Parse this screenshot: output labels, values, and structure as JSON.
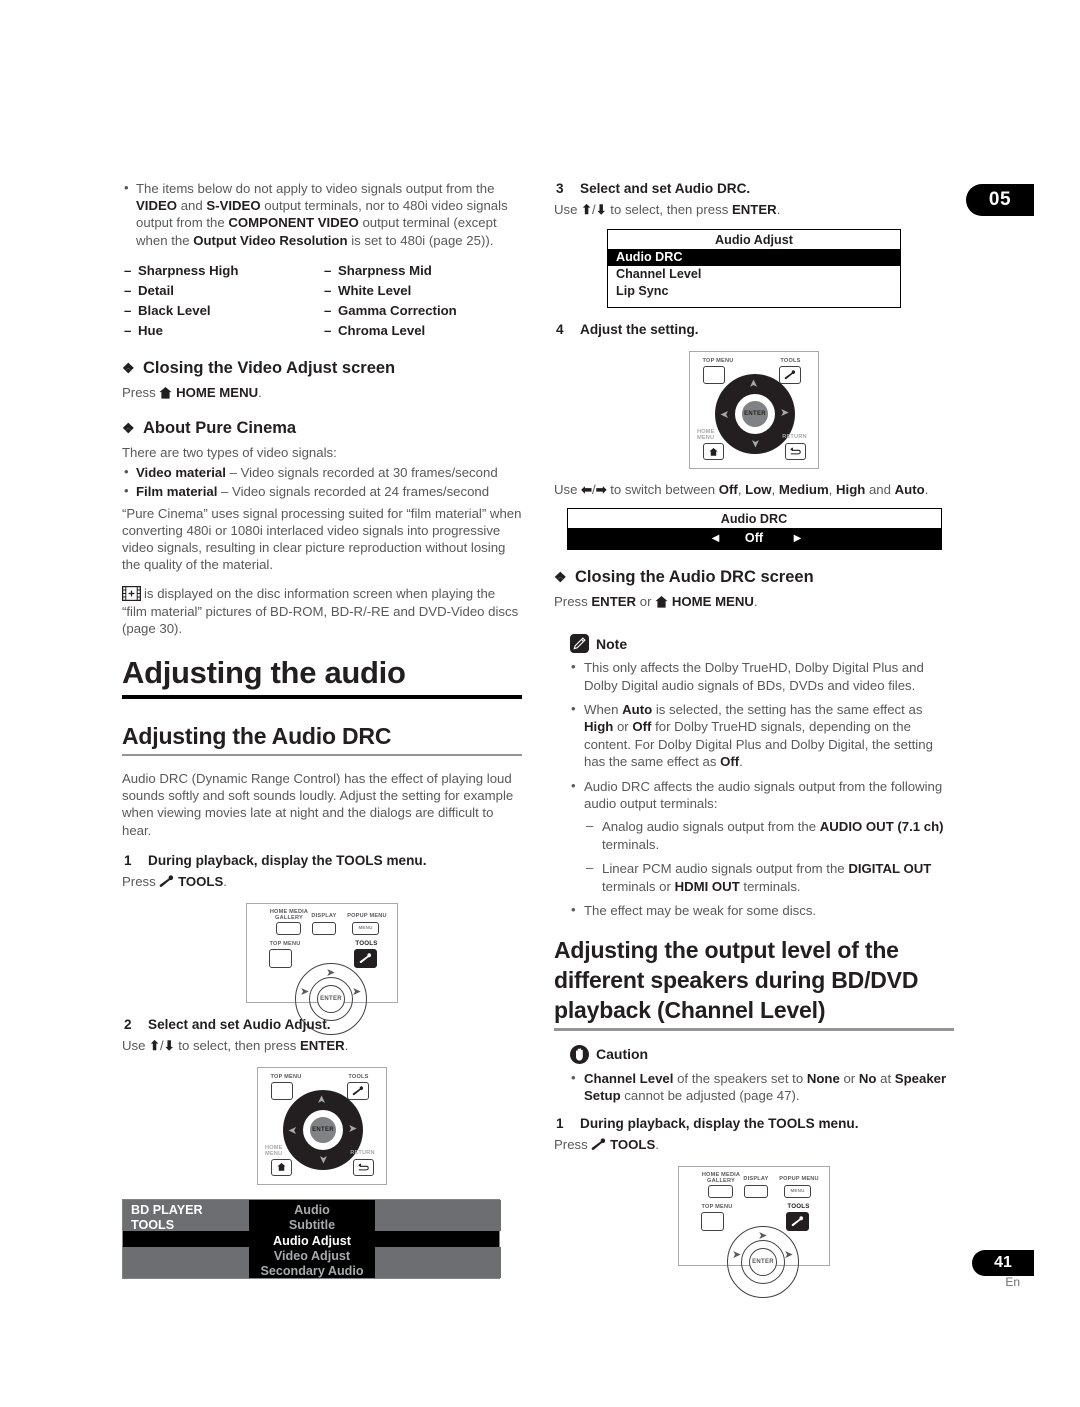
{
  "chapter_tab": "05",
  "page_number": "41",
  "page_lang": "En",
  "left_column": {
    "intro_bullet": {
      "text_parts": [
        {
          "t": "The items below do not apply to video signals output from the ",
          "b": false
        },
        {
          "t": "VIDEO",
          "b": true
        },
        {
          "t": " and ",
          "b": false
        },
        {
          "t": "S-VIDEO",
          "b": true
        },
        {
          "t": " output terminals, nor to 480i video signals output from the ",
          "b": false
        },
        {
          "t": "COMPONENT VIDEO",
          "b": true
        },
        {
          "t": " output terminal (except when the ",
          "b": false
        },
        {
          "t": "Output Video Resolution",
          "b": true
        },
        {
          "t": " is set to 480i (page 25)).",
          "b": false
        }
      ]
    },
    "items_col1": [
      "Sharpness High",
      "Detail",
      "Black Level",
      "Hue"
    ],
    "items_col2": [
      "Sharpness Mid",
      "White Level",
      "Gamma Correction",
      "Chroma Level"
    ],
    "closing_video_heading": "Closing the Video Adjust screen",
    "closing_video_press_pre": "Press",
    "closing_video_press_key": "HOME MENU",
    "closing_video_press_post": ".",
    "pure_cinema_heading": "About Pure Cinema",
    "pure_cinema_intro": "There are two types of video signals:",
    "signal_types": [
      {
        "label": "Video material",
        "desc": " – Video signals recorded at 30 frames/second"
      },
      {
        "label": "Film material",
        "desc": " – Video signals recorded at 24 frames/second"
      }
    ],
    "pure_cinema_body": "“Pure Cinema” uses signal processing suited for “film material” when converting 480i or 1080i interlaced video signals into progressive video signals, resulting in clear picture reproduction without losing the quality of the material.",
    "film_icon_paragraph": "is displayed on the disc information screen when playing the “film material” pictures of BD-ROM, BD-R/-RE and DVD-Video discs (page 30).",
    "main_heading": "Adjusting the audio",
    "sub_heading": "Adjusting the Audio DRC",
    "drc_body": "Audio DRC (Dynamic Range Control) has the effect of playing loud sounds softly and soft sounds loudly. Adjust the setting for example when viewing movies late at night and the dialogs are difficult to hear.",
    "step1_num": "1",
    "step1_text": "During playback, display the TOOLS menu.",
    "step1_press_pre": "Press",
    "step1_press_key": "TOOLS",
    "step1_press_post": ".",
    "step2_num": "2",
    "step2_text": "Select and set Audio Adjust.",
    "step2_use_pre": "Use",
    "step2_use_mid": "to select, then press",
    "step2_use_key": "ENTER",
    "step2_use_post": ".",
    "remote1": {
      "home_media_gallery": "HOME MEDIA\nGALLERY",
      "display": "DISPLAY",
      "popup_menu": "POPUP MENU",
      "popup_menu_btn": "MENU",
      "top_menu": "TOP MENU",
      "tools": "TOOLS",
      "enter": "ENTER"
    },
    "remote2": {
      "top_menu": "TOP MENU",
      "tools": "TOOLS",
      "home_menu": "HOME\nMENU",
      "return": "RETURN",
      "enter": "ENTER"
    },
    "bd_osd": {
      "title_line1": "BD PLAYER",
      "title_line2": "TOOLS",
      "items": [
        "Audio",
        "Subtitle",
        "Audio Adjust",
        "Video Adjust",
        "Secondary Audio"
      ],
      "selected": "Audio Adjust"
    }
  },
  "right_column": {
    "step3_num": "3",
    "step3_text": "Select and set Audio DRC.",
    "step3_use_pre": "Use",
    "step3_use_mid": "to select, then press",
    "step3_use_key": "ENTER",
    "step3_use_post": ".",
    "audio_adjust_osd": {
      "title": "Audio Adjust",
      "rows": [
        "Audio DRC",
        "Channel Level",
        "Lip Sync"
      ],
      "selected": "Audio DRC"
    },
    "step4_num": "4",
    "step4_text": "Adjust the setting.",
    "remote3": {
      "top_menu": "TOP MENU",
      "tools": "TOOLS",
      "home_menu": "HOME\nMENU",
      "return": "RETURN",
      "enter": "ENTER"
    },
    "switch_line_pre": "Use",
    "switch_line_mid": "to switch between",
    "switch_options": [
      "Off",
      "Low",
      "Medium",
      "High"
    ],
    "switch_last": "Auto",
    "audio_drc_osd": {
      "title": "Audio DRC",
      "value": "Off",
      "left_arrow": "◄",
      "right_arrow": "►"
    },
    "closing_drc_heading": "Closing the Audio DRC screen",
    "closing_drc_press_pre": "Press",
    "closing_drc_key1": "ENTER",
    "closing_drc_or": "or",
    "closing_drc_key2": "HOME MENU",
    "closing_drc_post": ".",
    "note_label": "Note",
    "note_items": [
      "This only affects the Dolby TrueHD, Dolby Digital Plus and Dolby Digital audio signals of BDs, DVDs and video files.",
      "AUTO_BULLET",
      "Audio DRC affects the audio signals output from the following audio output terminals:",
      "The effect may be weak for some discs."
    ],
    "note_auto_parts": [
      {
        "t": "When ",
        "b": false
      },
      {
        "t": "Auto",
        "b": true
      },
      {
        "t": " is selected, the setting has the same effect as ",
        "b": false
      },
      {
        "t": "High",
        "b": true
      },
      {
        "t": " or ",
        "b": false
      },
      {
        "t": "Off",
        "b": true
      },
      {
        "t": " for Dolby TrueHD signals, depending on the content. For Dolby Digital Plus and Dolby Digital, the setting has the same effect as ",
        "b": false
      },
      {
        "t": "Off",
        "b": true
      },
      {
        "t": ".",
        "b": false
      }
    ],
    "note_sub_items": [
      [
        {
          "t": "Analog audio signals output from the ",
          "b": false
        },
        {
          "t": "AUDIO OUT (7.1 ch)",
          "b": true
        },
        {
          "t": " terminals.",
          "b": false
        }
      ],
      [
        {
          "t": "Linear PCM audio signals output from the ",
          "b": false
        },
        {
          "t": "DIGITAL OUT",
          "b": true
        },
        {
          "t": " terminals or ",
          "b": false
        },
        {
          "t": "HDMI OUT",
          "b": true
        },
        {
          "t": " terminals.",
          "b": false
        }
      ]
    ],
    "channel_level_heading": "Adjusting the output level of the different speakers during BD/DVD playback (Channel Level)",
    "caution_label": "Caution",
    "caution_parts": [
      {
        "t": "Channel Level",
        "b": true
      },
      {
        "t": " of the speakers set to ",
        "b": false
      },
      {
        "t": "None",
        "b": true
      },
      {
        "t": " or ",
        "b": false
      },
      {
        "t": "No",
        "b": true
      },
      {
        "t": " at ",
        "b": false
      },
      {
        "t": "Speaker Setup",
        "b": true
      },
      {
        "t": " cannot be adjusted (page 47).",
        "b": false
      }
    ],
    "cl_step1_num": "1",
    "cl_step1_text": "During playback, display the TOOLS menu.",
    "cl_step1_press_pre": "Press",
    "cl_step1_press_key": "TOOLS",
    "cl_step1_press_post": ".",
    "remote4": {
      "home_media_gallery": "HOME MEDIA\nGALLERY",
      "display": "DISPLAY",
      "popup_menu": "POPUP MENU",
      "popup_menu_btn": "MENU",
      "top_menu": "TOP MENU",
      "tools": "TOOLS",
      "enter": "ENTER"
    }
  },
  "colors": {
    "body_text": "#58595b",
    "bold_text": "#231f20",
    "rule_thick": "#000000",
    "rule_thin": "#939598",
    "osd_selected_bg": "#000000",
    "osd_grey": "#6d6e71"
  }
}
